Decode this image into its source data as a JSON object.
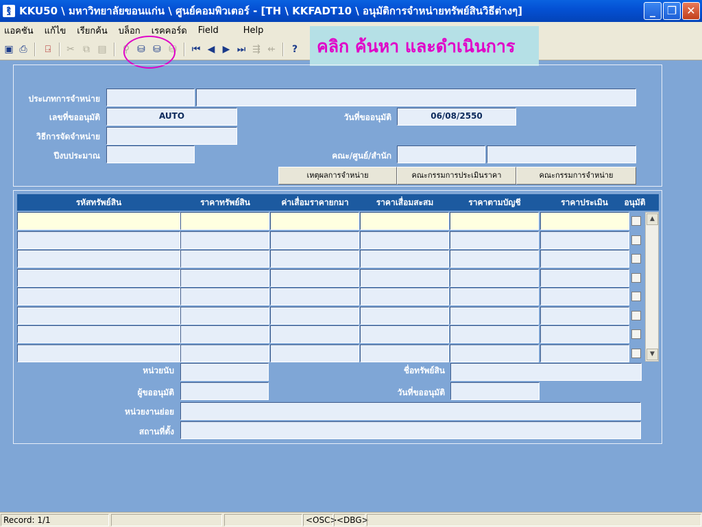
{
  "window": {
    "app_icon_text": "ฐิ",
    "title": "KKU50 \\ มหาวิทยาลัยขอนแก่น \\ ศูนย์คอมพิวเตอร์ - [TH \\ KKFADT10 \\ อนุมัติการจำหน่ายทรัพย์สินวิธีต่างๆ]"
  },
  "menu": [
    "แอคชัน",
    "แก้ไข",
    "เรียกค้น",
    "บล็อก",
    "เรคคอร์ด",
    "Field",
    "Help"
  ],
  "toolbar": {
    "icons": [
      "save-icon",
      "print-preview-icon",
      "exit-icon",
      "cut-icon",
      "copy-icon",
      "paste-icon",
      "enter-query-icon",
      "execute-query-icon",
      "count-query-icon",
      "cancel-query-icon",
      "first-record-icon",
      "previous-record-icon",
      "next-record-icon",
      "last-record-icon",
      "insert-record-icon",
      "delete-record-icon",
      "help-icon"
    ]
  },
  "callout": "คลิก ค้นหา และดำเนินการ",
  "header_form": {
    "type_label": "ประเภทการจำหน่าย",
    "type_code": "",
    "type_desc": "",
    "request_no_label": "เลขที่ขออนุมัติ",
    "request_no": "AUTO",
    "request_date_label": "วันที่ขออนุมัติ",
    "request_date": "06/08/2550",
    "method_label": "วิธีการจัดจำหน่าย",
    "method": "",
    "fiscal_year_label": "ปีงบประมาณ",
    "fiscal_year": "",
    "faculty_label": "คณะ/ศูนย์/สำนัก",
    "faculty_code": "",
    "faculty_name": "",
    "buttons": [
      "เหตุผลการจำหน่าย",
      "คณะกรรมการประเมินราคา",
      "คณะกรรมการจำหน่าย"
    ]
  },
  "grid": {
    "columns": [
      "รหัสทรัพย์สิน",
      "ราคาทรัพย์สิน",
      "ค่าเสื่อมราคายกมา",
      "ราคาเสื่อมสะสม",
      "ราคาตามบัญชี",
      "ราคาประเมิน",
      "อนุมัติ"
    ],
    "row_count": 8,
    "rows": []
  },
  "detail_form": {
    "unit_label": "หน่วยนับ",
    "unit": "",
    "asset_name_label": "ชื่อทรัพย์สิน",
    "asset_name": "",
    "requester_label": "ผู้ขออนุมัติ",
    "requester": "",
    "date_label": "วันที่ขออนุมัติ",
    "date": "",
    "subunit_label": "หน่วยงานย่อย",
    "subunit": "",
    "location_label": "สถานที่ตั้ง",
    "location": ""
  },
  "status": {
    "record": "Record: 1/1",
    "osc": "<OSC>",
    "dbg": "<DBG>"
  }
}
